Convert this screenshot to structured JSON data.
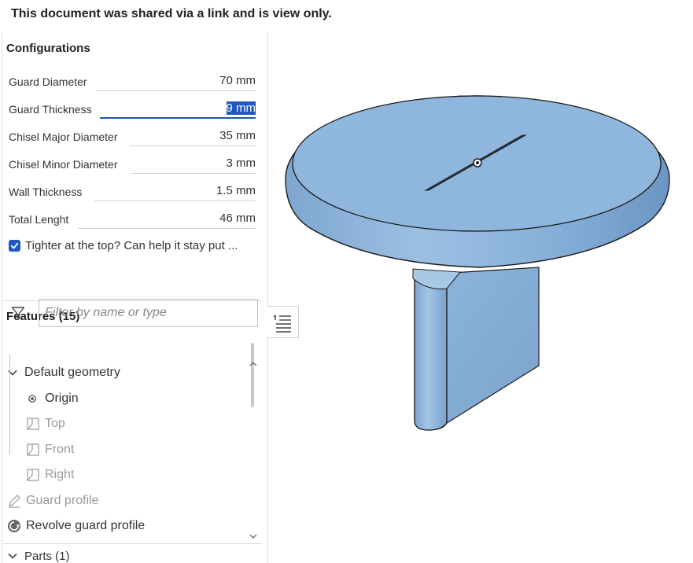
{
  "banner": {
    "text": "This document was shared via a link and is view only."
  },
  "configurations": {
    "title": "Configurations",
    "fields": [
      {
        "label": "Guard Diameter",
        "value": "70 mm"
      },
      {
        "label": "Guard Thickness",
        "value": "9 mm"
      },
      {
        "label": "Chisel Major Diameter",
        "value": "35 mm"
      },
      {
        "label": "Chisel Minor Diameter",
        "value": "3 mm"
      },
      {
        "label": "Wall Thickness",
        "value": "1.5 mm"
      },
      {
        "label": "Total Lenght",
        "value": "46 mm"
      }
    ],
    "checkbox": {
      "label": "Tighter at the top? Can help it stay put ...",
      "checked": true
    }
  },
  "features": {
    "title": "Features (15)",
    "filter_placeholder": "Filter by name or type",
    "group": "Default geometry",
    "items": {
      "origin": "Origin",
      "top": "Top",
      "front": "Front",
      "right": "Right",
      "guard_profile": "Guard profile",
      "revolve": "Revolve guard profile"
    },
    "icons": [
      "filter-icon",
      "chevron-down-icon",
      "origin-icon",
      "plane-icon",
      "sketch-icon",
      "revolve-icon",
      "list-icon"
    ]
  },
  "parts": {
    "title": "Parts (1)"
  },
  "colors": {
    "accent": "#1f57c3",
    "model": "#8fb6dc"
  }
}
